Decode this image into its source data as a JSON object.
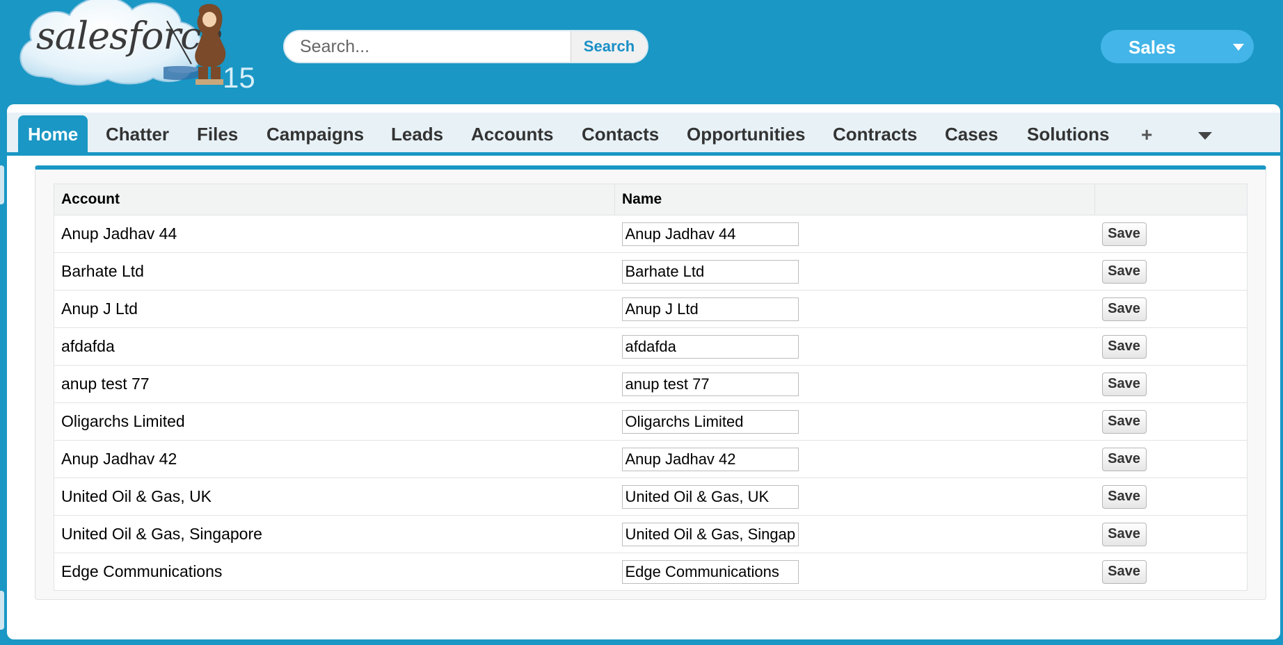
{
  "logo": {
    "text": "salesforce",
    "edition": "15"
  },
  "search": {
    "placeholder": "Search...",
    "button_label": "Search"
  },
  "app_switcher": {
    "label": "Sales"
  },
  "tabs": [
    {
      "label": "Home",
      "active": true
    },
    {
      "label": "Chatter"
    },
    {
      "label": "Files"
    },
    {
      "label": "Campaigns"
    },
    {
      "label": "Leads"
    },
    {
      "label": "Accounts"
    },
    {
      "label": "Contacts"
    },
    {
      "label": "Opportunities"
    },
    {
      "label": "Contracts"
    },
    {
      "label": "Cases"
    },
    {
      "label": "Solutions"
    }
  ],
  "tab_extras": {
    "plus": "+"
  },
  "table": {
    "headers": {
      "account": "Account",
      "name": "Name",
      "action": ""
    },
    "save_label": "Save",
    "rows": [
      {
        "account": "Anup Jadhav 44",
        "name": "Anup Jadhav 44"
      },
      {
        "account": "Barhate Ltd",
        "name": "Barhate Ltd"
      },
      {
        "account": "Anup J Ltd",
        "name": "Anup J Ltd"
      },
      {
        "account": "afdafda",
        "name": "afdafda"
      },
      {
        "account": "anup test 77",
        "name": "anup test 77"
      },
      {
        "account": "Oligarchs Limited",
        "name": "Oligarchs Limited"
      },
      {
        "account": "Anup Jadhav 42",
        "name": "Anup Jadhav 42"
      },
      {
        "account": "United Oil & Gas, UK",
        "name": "United Oil & Gas, UK"
      },
      {
        "account": "United Oil & Gas, Singapore",
        "name": "United Oil & Gas, Singapore"
      },
      {
        "account": "Edge Communications",
        "name": "Edge Communications"
      }
    ]
  },
  "colors": {
    "brand": "#1a97c4",
    "link": "#1a8fc6",
    "app_switcher": "#43b5e8"
  }
}
